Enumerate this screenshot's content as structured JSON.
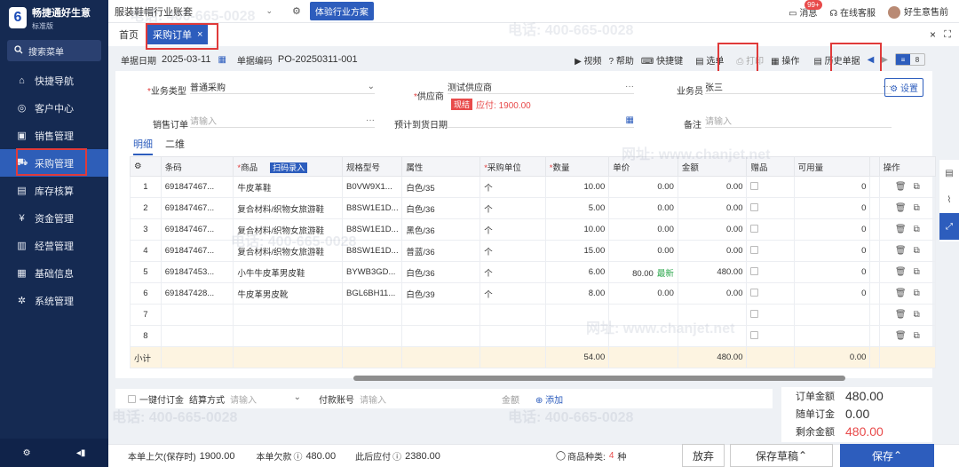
{
  "sidebar": {
    "brand_name": "畅捷通好生意",
    "brand_edition": "标准版",
    "search_label": "搜索菜单",
    "items": [
      {
        "label": "快捷导航"
      },
      {
        "label": "客户中心"
      },
      {
        "label": "销售管理"
      },
      {
        "label": "采购管理"
      },
      {
        "label": "库存核算"
      },
      {
        "label": "资金管理"
      },
      {
        "label": "经营管理"
      },
      {
        "label": "基础信息"
      },
      {
        "label": "系统管理"
      }
    ]
  },
  "topbar": {
    "account_set": "服装鞋帽行业账套",
    "trial_button": "体验行业方案",
    "messages_label": "消息",
    "messages_badge": "99+",
    "support_label": "在线客服",
    "user_name": "好生意售前"
  },
  "tabs": {
    "home": "首页",
    "active": "采购订单"
  },
  "doc": {
    "date_label": "单据日期",
    "date_value": "2025-03-11",
    "code_label": "单据编码",
    "code_value": "PO-20250311-001"
  },
  "toolbar": {
    "video": "视频",
    "help": "帮助",
    "shortcut": "快捷键",
    "select": "选单",
    "print": "打印",
    "operate": "操作",
    "history": "历史单据"
  },
  "form": {
    "biz_type_label": "业务类型",
    "biz_type_value": "普通采购",
    "supplier_label": "供应商",
    "supplier_value": "测试供应商",
    "cash_tag": "现结",
    "payable_text": "应付: 1900.00",
    "salesman_label": "业务员",
    "salesman_value": "张三",
    "settings_btn": "设置",
    "sales_order_label": "销售订单",
    "sales_order_ph": "请输入",
    "arrival_label": "预计到货日期",
    "remark_label": "备注",
    "remark_ph": "请输入"
  },
  "subtabs": {
    "detail": "明细",
    "dimension": "二维"
  },
  "table": {
    "headers": {
      "barcode": "条码",
      "product": "商品",
      "scan": "扫码录入",
      "spec": "规格型号",
      "attr": "属性",
      "unit": "采购单位",
      "qty": "数量",
      "price": "单价",
      "amount": "金额",
      "gift": "赠品",
      "available": "可用量",
      "ops": "操作"
    },
    "rows": [
      {
        "no": "1",
        "barcode": "691847467...",
        "product": "牛皮革鞋",
        "spec": "B0VW9X1...",
        "attr": "白色/35",
        "unit": "个",
        "qty": "10.00",
        "price": "0.00",
        "amount": "0.00",
        "available": "0"
      },
      {
        "no": "2",
        "barcode": "691847467...",
        "product": "复合材料/织物女旅游鞋",
        "spec": "B8SW1E1D...",
        "attr": "白色/36",
        "unit": "个",
        "qty": "5.00",
        "price": "0.00",
        "amount": "0.00",
        "available": "0"
      },
      {
        "no": "3",
        "barcode": "691847467...",
        "product": "复合材料/织物女旅游鞋",
        "spec": "B8SW1E1D...",
        "attr": "黑色/36",
        "unit": "个",
        "qty": "10.00",
        "price": "0.00",
        "amount": "0.00",
        "available": "0"
      },
      {
        "no": "4",
        "barcode": "691847467...",
        "product": "复合材料/织物女旅游鞋",
        "spec": "B8SW1E1D...",
        "attr": "普蓝/36",
        "unit": "个",
        "qty": "15.00",
        "price": "0.00",
        "amount": "0.00",
        "available": "0"
      },
      {
        "no": "5",
        "barcode": "691847453...",
        "product": "小牛牛皮革男皮鞋",
        "spec": "BYWB3GD...",
        "attr": "白色/36",
        "unit": "个",
        "qty": "6.00",
        "price": "80.00",
        "latest": "最新",
        "amount": "480.00",
        "available": "0"
      },
      {
        "no": "6",
        "barcode": "691847428...",
        "product": "牛皮革男皮靴",
        "spec": "BGL6BH11...",
        "attr": "白色/39",
        "unit": "个",
        "qty": "8.00",
        "price": "0.00",
        "amount": "0.00",
        "available": "0"
      },
      {
        "no": "7"
      },
      {
        "no": "8"
      }
    ],
    "subtotal_label": "小计",
    "subtotal_qty": "54.00",
    "subtotal_amount": "480.00",
    "subtotal_available": "0.00"
  },
  "bottom": {
    "one_key": "一键付订金",
    "settle_label": "结算方式",
    "settle_ph": "请输入",
    "account_label": "付款账号",
    "account_ph": "请输入",
    "amount_label": "金额",
    "add_label": "添加"
  },
  "summary": {
    "order_amount_label": "订单金额",
    "order_amount": "480.00",
    "deposit_label": "随单订金",
    "deposit": "0.00",
    "remain_label": "剩余金额",
    "remain": "480.00"
  },
  "footer": {
    "prev_owed_label": "本单上欠(保存时)",
    "prev_owed": "1900.00",
    "this_owed_label": "本单欠款",
    "this_owed": "480.00",
    "after_label": "此后应付",
    "after": "2380.00",
    "kinds_label": "商品种类:",
    "kinds_value": "4",
    "kinds_unit": "种",
    "abandon": "放弃",
    "save_draft": "保存草稿",
    "save": "保存"
  },
  "watermark": {
    "phone": "电话: 400-665-0028",
    "site": "网址: www.chanjet.net"
  },
  "colors": {
    "brand": "#2d5dbd",
    "sidebar": "#152a52",
    "danger": "#e84b4b"
  }
}
